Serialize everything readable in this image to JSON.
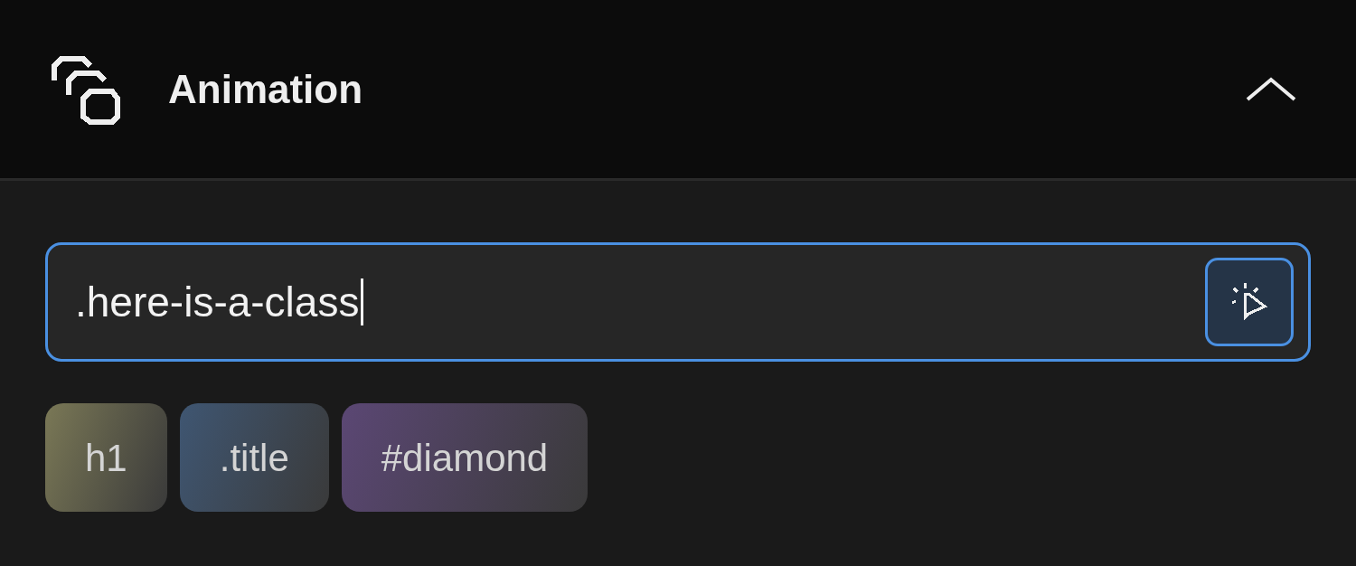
{
  "panel": {
    "title": "Animation",
    "expanded": true
  },
  "selector_field": {
    "value": ".here-is-a-class",
    "focused": true
  },
  "tags": [
    {
      "label": "h1",
      "color": "#7a7856"
    },
    {
      "label": ".title",
      "color": "#3f5672"
    },
    {
      "label": "#diamond",
      "color": "#5b4774"
    }
  ]
}
